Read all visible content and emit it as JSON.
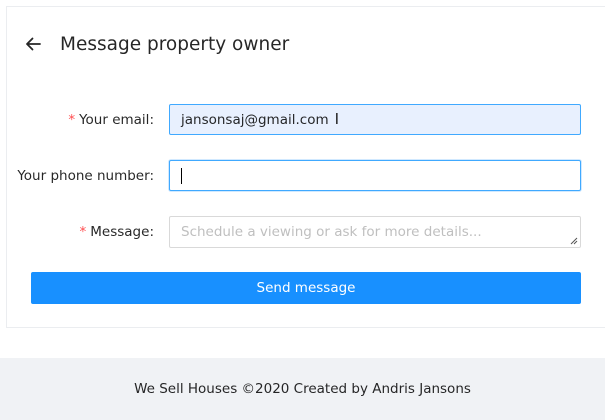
{
  "header": {
    "title": "Message property owner",
    "back_icon": "arrow-left-icon"
  },
  "form": {
    "email": {
      "required": true,
      "label": "Your email",
      "value": "jansonsaj@gmail.com"
    },
    "phone": {
      "required": false,
      "label": "Your phone number",
      "value": ""
    },
    "message": {
      "required": true,
      "label": "Message",
      "placeholder": "Schedule a viewing or ask for more details..."
    },
    "submit_label": "Send message"
  },
  "footer": {
    "text": "We Sell Houses ©2020 Created by Andris Jansons"
  },
  "colors": {
    "primary": "#1890ff",
    "required": "#ff4d4f",
    "footer_bg": "#f0f2f5",
    "autofill_bg": "#e8f0fe"
  }
}
